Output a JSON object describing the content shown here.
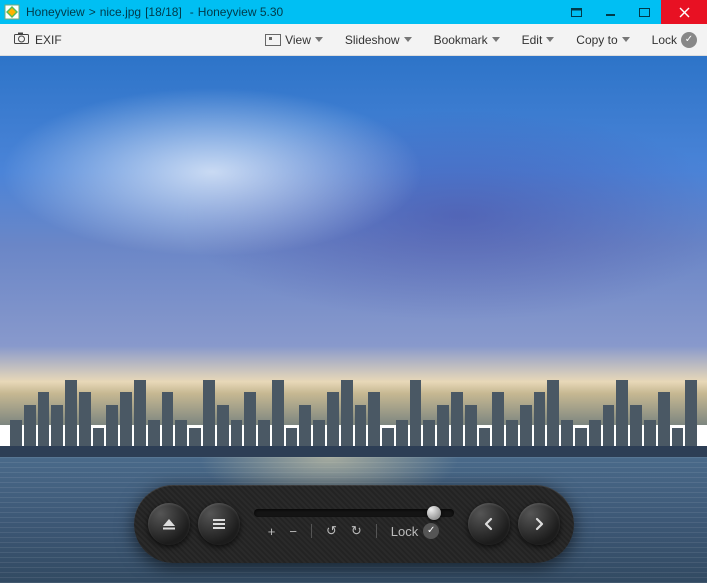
{
  "title": {
    "app": "Honeyview",
    "separator": ">",
    "filename": "nice.jpg",
    "index": "[18/18]",
    "dash": "-",
    "appver": "Honeyview 5.30"
  },
  "toolbar": {
    "exif": "EXIF",
    "view": "View",
    "slideshow": "Slideshow",
    "bookmark": "Bookmark",
    "edit": "Edit",
    "copyto": "Copy to",
    "lock": "Lock"
  },
  "osd": {
    "lock": "Lock",
    "plus": "+",
    "minus": "−",
    "undo": "↺",
    "redo": "↻"
  }
}
